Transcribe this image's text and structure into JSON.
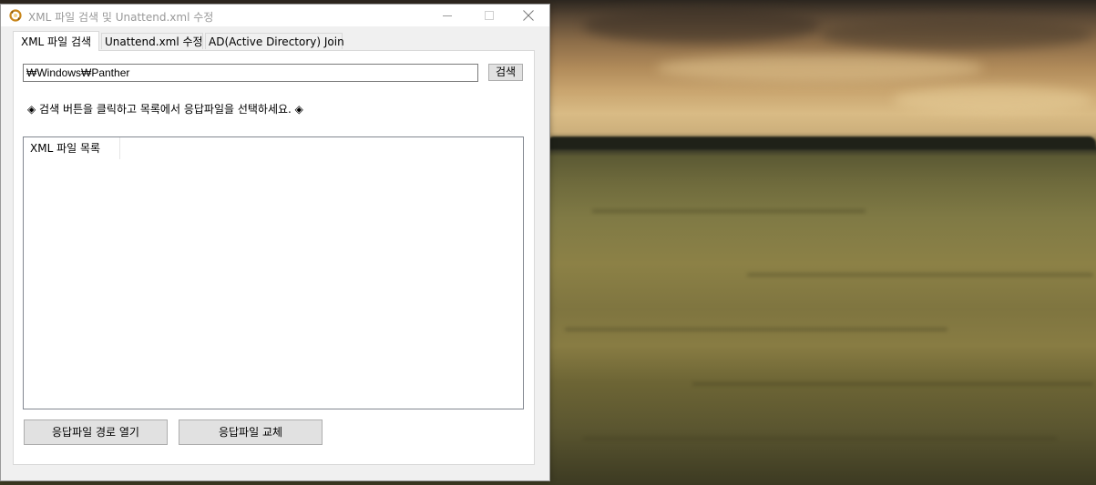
{
  "window": {
    "title": "XML 파일 검색 및 Unattend.xml 수정"
  },
  "tabs": [
    {
      "label": "XML 파일 검색",
      "active": true
    },
    {
      "label": "Unattend.xml 수정",
      "active": false
    },
    {
      "label": "AD(Active Directory) Join",
      "active": false
    }
  ],
  "search": {
    "path_value": "₩Windows₩Panther",
    "button_label": "검색"
  },
  "instruction": "◈ 검색 버튼을 클릭하고 목록에서 응답파일을 선택하세요. ◈",
  "list": {
    "column_header": "XML 파일 목록",
    "rows": []
  },
  "actions": {
    "open_path_label": "응답파일 경로 열기",
    "replace_label": "응답파일 교체"
  },
  "icons": {
    "app": "app-sync-icon",
    "minimize": "minimize-icon",
    "maximize": "maximize-icon",
    "close": "close-icon"
  }
}
